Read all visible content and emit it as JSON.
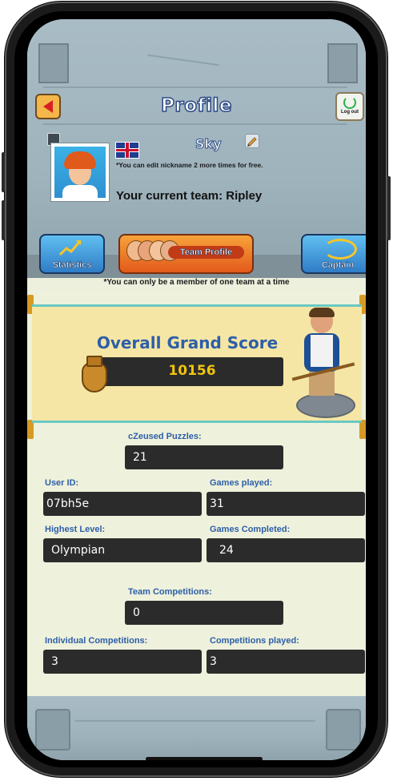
{
  "header": {
    "title": "Profile",
    "logout_label": "Log out"
  },
  "profile": {
    "nickname": "Sky",
    "nickname_note": "*You can edit nickname 2 more times for free.",
    "team_line": "Your current team: Ripley",
    "country": "United Kingdom"
  },
  "tabs": [
    {
      "label": "Statistics"
    },
    {
      "label": "Team Profile"
    },
    {
      "label": "Captain"
    }
  ],
  "team_notice": "*You can only be a member of one team at a time",
  "grand_score": {
    "title": "Overall Grand Score",
    "value": "10156"
  },
  "stats": {
    "czeused_puzzles": {
      "label": "cZeused Puzzles:",
      "value": "21"
    },
    "user_id": {
      "label": "User ID:",
      "value": "07bh5e"
    },
    "games_played": {
      "label": "Games played:",
      "value": "31"
    },
    "highest_level": {
      "label": "Highest Level:",
      "value": "Olympian"
    },
    "games_completed": {
      "label": "Games Completed:",
      "value": "24"
    },
    "team_competitions": {
      "label": "Team Competitions:",
      "value": "0"
    },
    "individual_competitions": {
      "label": "Individual Competitions:",
      "value": "3"
    },
    "competitions_played": {
      "label": "Competitions played:",
      "value": "3"
    }
  },
  "colors": {
    "accent_blue": "#2d5fa8",
    "score_gold": "#f1c40f",
    "stone": "#a9bcc6",
    "band_yellow": "#f6e6a5"
  },
  "icons": [
    "back-arrow-icon",
    "power-icon",
    "uk-flag-icon",
    "edit-pencil-icon",
    "frame-icon",
    "chart-icon",
    "captain-helmet-icon",
    "amphora-icon"
  ]
}
